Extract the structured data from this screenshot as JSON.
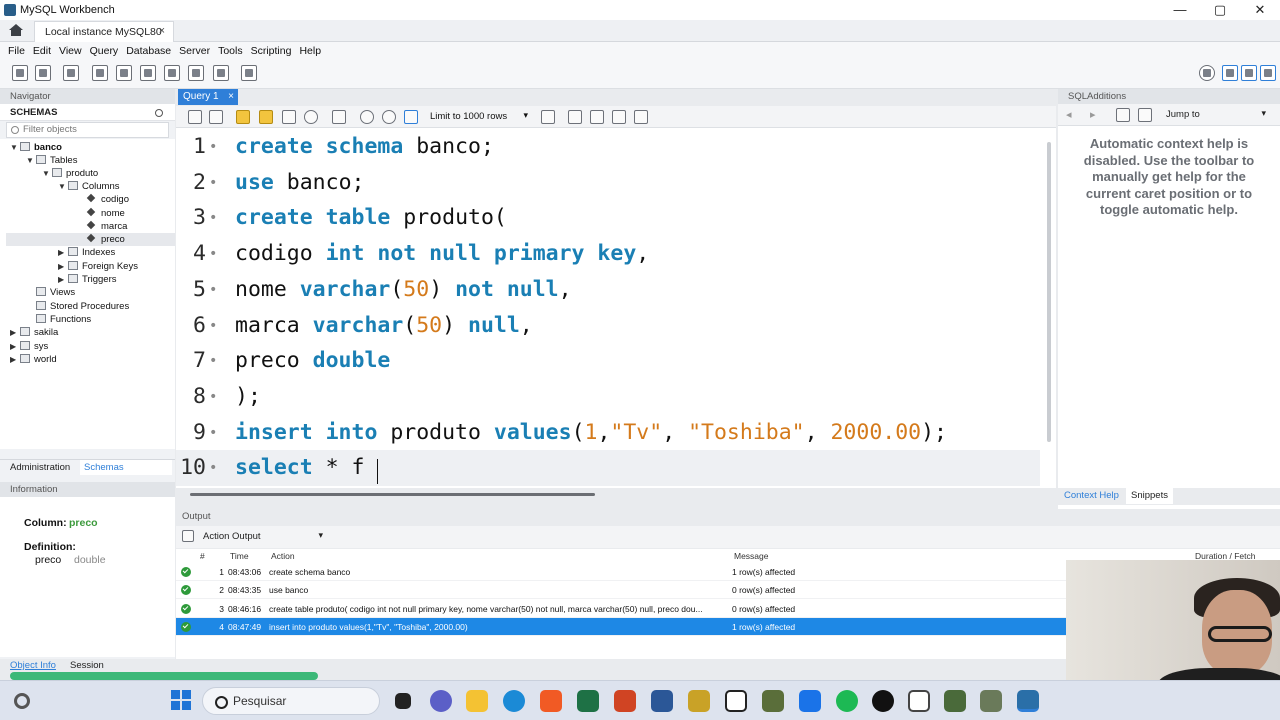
{
  "window": {
    "title": "MySQL Workbench",
    "controls": [
      "—",
      "▢",
      "✕"
    ]
  },
  "connection_tab": {
    "label": "Local instance MySQL80",
    "close": "×"
  },
  "menu": [
    "File",
    "Edit",
    "View",
    "Query",
    "Database",
    "Server",
    "Tools",
    "Scripting",
    "Help"
  ],
  "navigator": {
    "header": "Navigator",
    "schemas_title": "SCHEMAS",
    "filter_placeholder": "Filter objects",
    "tree": [
      {
        "label": "banco",
        "level": 0,
        "expanded": true,
        "bold": true
      },
      {
        "label": "Tables",
        "level": 1,
        "expanded": true
      },
      {
        "label": "produto",
        "level": 2,
        "expanded": true
      },
      {
        "label": "Columns",
        "level": 3,
        "expanded": true
      },
      {
        "label": "codigo",
        "level": 4
      },
      {
        "label": "nome",
        "level": 4
      },
      {
        "label": "marca",
        "level": 4
      },
      {
        "label": "preco",
        "level": 4,
        "selected": true
      },
      {
        "label": "Indexes",
        "level": 3
      },
      {
        "label": "Foreign Keys",
        "level": 3
      },
      {
        "label": "Triggers",
        "level": 3
      },
      {
        "label": "Views",
        "level": 1
      },
      {
        "label": "Stored Procedures",
        "level": 1
      },
      {
        "label": "Functions",
        "level": 1
      },
      {
        "label": "sakila",
        "level": 0
      },
      {
        "label": "sys",
        "level": 0
      },
      {
        "label": "world",
        "level": 0
      }
    ],
    "tabs": [
      "Administration",
      "Schemas"
    ],
    "info_header": "Information",
    "info": {
      "column_label": "Column:",
      "column_value": "preco",
      "definition_label": "Definition:",
      "def_name": "preco",
      "def_type": "double"
    },
    "bottom_tabs": [
      "Object Info",
      "Session"
    ]
  },
  "query": {
    "tab_label": "Query 1",
    "tab_close": "×",
    "limit": "Limit to 1000 rows",
    "lines": [
      {
        "num": "1",
        "tokens": [
          [
            "kw",
            "create schema"
          ],
          [
            "t",
            " banco;"
          ]
        ]
      },
      {
        "num": "2",
        "tokens": [
          [
            "kw",
            "use"
          ],
          [
            "t",
            " banco;"
          ]
        ]
      },
      {
        "num": "3",
        "tokens": [
          [
            "kw",
            "create table"
          ],
          [
            "t",
            " produto("
          ]
        ]
      },
      {
        "num": "4",
        "tokens": [
          [
            "t",
            "codigo "
          ],
          [
            "kw",
            "int not null primary key"
          ],
          [
            "t",
            ","
          ]
        ]
      },
      {
        "num": "5",
        "tokens": [
          [
            "t",
            "nome "
          ],
          [
            "kw",
            "varchar"
          ],
          [
            "t",
            "("
          ],
          [
            "nm",
            "50"
          ],
          [
            "t",
            ") "
          ],
          [
            "kw",
            "not null"
          ],
          [
            "t",
            ","
          ]
        ]
      },
      {
        "num": "6",
        "tokens": [
          [
            "t",
            "marca "
          ],
          [
            "kw",
            "varchar"
          ],
          [
            "t",
            "("
          ],
          [
            "nm",
            "50"
          ],
          [
            "t",
            ") "
          ],
          [
            "kw",
            "null"
          ],
          [
            "t",
            ","
          ]
        ]
      },
      {
        "num": "7",
        "tokens": [
          [
            "t",
            "preco "
          ],
          [
            "kw",
            "double"
          ]
        ]
      },
      {
        "num": "8",
        "tokens": [
          [
            "t",
            ");"
          ]
        ]
      },
      {
        "num": "9",
        "tokens": [
          [
            "kw",
            "insert into"
          ],
          [
            "t",
            " produto "
          ],
          [
            "kw",
            "values"
          ],
          [
            "t",
            "("
          ],
          [
            "nm",
            "1"
          ],
          [
            "t",
            ","
          ],
          [
            "st",
            "\"Tv\""
          ],
          [
            "t",
            ", "
          ],
          [
            "st",
            "\"Toshiba\""
          ],
          [
            "t",
            ", "
          ],
          [
            "nm",
            "2000.00"
          ],
          [
            "t",
            ");"
          ]
        ]
      },
      {
        "num": "10",
        "tokens": [
          [
            "kw",
            "select"
          ],
          [
            "t",
            " * f"
          ]
        ]
      }
    ]
  },
  "sql_additions": {
    "header": "SQLAdditions",
    "jump_to": "Jump to",
    "help_text": "Automatic context help is disabled. Use the toolbar to manually get help for the current caret position or to toggle automatic help.",
    "tabs": [
      "Context Help",
      "Snippets"
    ]
  },
  "output": {
    "header": "Output",
    "mode": "Action Output",
    "columns": [
      "#",
      "Time",
      "Action",
      "Message",
      "Duration / Fetch"
    ],
    "rows": [
      {
        "n": "1",
        "time": "08:43:06",
        "action": "create schema banco",
        "message": "1 row(s) affected"
      },
      {
        "n": "2",
        "time": "08:43:35",
        "action": "use banco",
        "message": "0 row(s) affected"
      },
      {
        "n": "3",
        "time": "08:46:16",
        "action": "create table produto( codigo int not null primary key, nome varchar(50) not null, marca varchar(50) null, preco dou...",
        "message": "0 row(s) affected"
      },
      {
        "n": "4",
        "time": "08:47:49",
        "action": "insert into produto values(1,\"Tv\", \"Toshiba\", 2000.00)",
        "message": "1 row(s) affected",
        "selected": true
      }
    ]
  },
  "taskbar": {
    "search_placeholder": "Pesquisar"
  },
  "colors": {
    "accent": "#2f7fd8",
    "keyword": "#1a7fb4",
    "number": "#d47a1b",
    "selected_row": "#1e88e5"
  }
}
